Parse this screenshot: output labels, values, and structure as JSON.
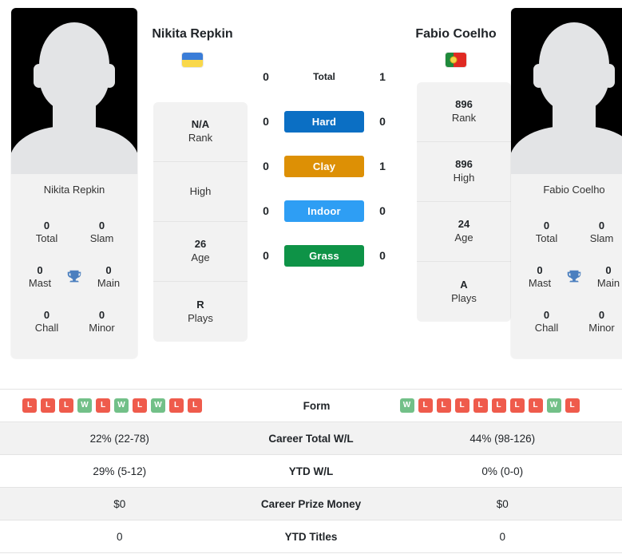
{
  "colors": {
    "hard": "#0b6fc4",
    "clay": "#dd9005",
    "indoor": "#2e9ef4",
    "grass": "#0e9347",
    "win": "#72c088",
    "loss": "#ef5b4c",
    "trophy": "#4b7fbf",
    "panel": "#f2f2f2"
  },
  "players": {
    "left": {
      "name": "Nikita Repkin",
      "photo_caption": "Nikita Repkin",
      "flag": "ukraine-flag",
      "titles": [
        {
          "value": "0",
          "label": "Total"
        },
        {
          "value": "0",
          "label": "Slam"
        },
        {
          "value": "0",
          "label": "Mast"
        },
        {
          "value": "0",
          "label": "Main"
        },
        {
          "value": "0",
          "label": "Chall"
        },
        {
          "value": "0",
          "label": "Minor"
        }
      ],
      "stats": [
        {
          "value": "N/A",
          "label": "Rank"
        },
        {
          "value": "",
          "label": "High"
        },
        {
          "value": "26",
          "label": "Age"
        },
        {
          "value": "R",
          "label": "Plays"
        }
      ],
      "form": [
        "L",
        "L",
        "L",
        "W",
        "L",
        "W",
        "L",
        "W",
        "L",
        "L"
      ],
      "career_total_wl": "22% (22-78)",
      "ytd_wl": "29% (5-12)",
      "career_prize_money": "$0",
      "ytd_titles": "0"
    },
    "right": {
      "name": "Fabio Coelho",
      "photo_caption": "Fabio Coelho",
      "flag": "portugal-flag",
      "titles": [
        {
          "value": "0",
          "label": "Total"
        },
        {
          "value": "0",
          "label": "Slam"
        },
        {
          "value": "0",
          "label": "Mast"
        },
        {
          "value": "0",
          "label": "Main"
        },
        {
          "value": "0",
          "label": "Chall"
        },
        {
          "value": "0",
          "label": "Minor"
        }
      ],
      "stats": [
        {
          "value": "896",
          "label": "Rank"
        },
        {
          "value": "896",
          "label": "High"
        },
        {
          "value": "24",
          "label": "Age"
        },
        {
          "value": "A",
          "label": "Plays"
        }
      ],
      "form": [
        "W",
        "L",
        "L",
        "L",
        "L",
        "L",
        "L",
        "L",
        "W",
        "L"
      ],
      "career_total_wl": "44% (98-126)",
      "ytd_wl": "0% (0-0)",
      "career_prize_money": "$0",
      "ytd_titles": "0"
    }
  },
  "h2h": {
    "rows": [
      {
        "key": "total",
        "label": "Total",
        "left": "0",
        "right": "1",
        "style": "plain"
      },
      {
        "key": "hard",
        "label": "Hard",
        "left": "0",
        "right": "0",
        "style": "badge"
      },
      {
        "key": "clay",
        "label": "Clay",
        "left": "0",
        "right": "1",
        "style": "badge"
      },
      {
        "key": "indoor",
        "label": "Indoor",
        "left": "0",
        "right": "0",
        "style": "badge"
      },
      {
        "key": "grass",
        "label": "Grass",
        "left": "0",
        "right": "0",
        "style": "badge"
      }
    ]
  },
  "table": {
    "rows": [
      {
        "label": "Form",
        "type": "form"
      },
      {
        "label": "Career Total W/L",
        "type": "text",
        "field": "career_total_wl"
      },
      {
        "label": "YTD W/L",
        "type": "text",
        "field": "ytd_wl"
      },
      {
        "label": "Career Prize Money",
        "type": "text",
        "field": "career_prize_money"
      },
      {
        "label": "YTD Titles",
        "type": "text",
        "field": "ytd_titles"
      }
    ]
  }
}
